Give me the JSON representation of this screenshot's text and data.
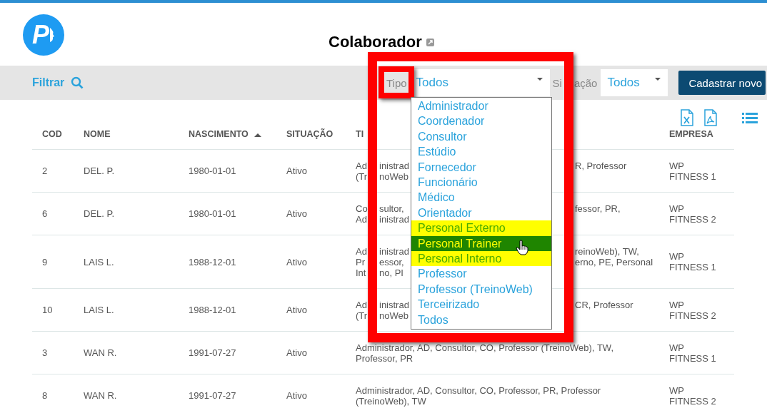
{
  "logo": {
    "text": "P"
  },
  "title": "Colaborador",
  "filter_bar": {
    "filter_label": "Filtrar",
    "tipo_label": "Tipo",
    "tipo_value": "Todos",
    "situacao_label": [
      "Si",
      "ação"
    ],
    "situacao_value": "Todos",
    "new_button": "Cadastrar novo"
  },
  "table": {
    "columns": [
      {
        "label": "COD",
        "sorted": false
      },
      {
        "label": "NOME",
        "sorted": false
      },
      {
        "label": "NASCIMENTO",
        "sorted": true
      },
      {
        "label": "SITUAÇÃO",
        "sorted": false
      },
      {
        "label": "TI",
        "sorted": false
      },
      {
        "label": "EMPRESA",
        "sorted": false
      }
    ],
    "rows": [
      {
        "cod": "2",
        "nome": "DEL. P.",
        "nascimento": "1980-01-01",
        "situacao": "Ativo",
        "tipo": [
          {
            "kind": "left",
            "lines": [
              "Ad",
              "(Tr"
            ]
          },
          {
            "kind": "middle",
            "lines": [
              "inistrad",
              "noWeb"
            ]
          },
          {
            "kind": "right",
            "lines": [
              "R, Professor"
            ]
          }
        ],
        "empresa": [
          "WP",
          "FITNESS 1"
        ]
      },
      {
        "cod": "6",
        "nome": "DEL. P.",
        "nascimento": "1980-01-01",
        "situacao": "Ativo",
        "tipo": [
          {
            "kind": "left",
            "lines": [
              "Co",
              "Ad"
            ]
          },
          {
            "kind": "middle",
            "lines": [
              "sultor,",
              "inistrad"
            ]
          },
          {
            "kind": "right",
            "lines": [
              "fessor, PR,"
            ]
          }
        ],
        "empresa": [
          "WP",
          "FITNESS 2"
        ]
      },
      {
        "cod": "9",
        "nome": "LAIS L.",
        "nascimento": "1988-12-01",
        "situacao": "Ativo",
        "tipo": [
          {
            "kind": "left",
            "lines": [
              "Ad",
              "Pr",
              "Int"
            ]
          },
          {
            "kind": "middle",
            "lines": [
              "inistrad",
              "essor,",
              "no, PI"
            ]
          },
          {
            "kind": "right",
            "lines": [
              "reinoWeb), TW,",
              "erno, PE, Personal"
            ]
          }
        ],
        "empresa": [
          "WP",
          "FITNESS 1"
        ]
      },
      {
        "cod": "10",
        "nome": "LAIS L.",
        "nascimento": "1988-12-01",
        "situacao": "Ativo",
        "tipo": [
          {
            "kind": "left",
            "lines": [
              "Ad",
              "(Tr"
            ]
          },
          {
            "kind": "middle",
            "lines": [
              "inistrad",
              "noWeb"
            ]
          },
          {
            "kind": "right",
            "lines": [
              "CR, Professor"
            ]
          }
        ],
        "empresa": [
          "WP",
          "FITNESS 2"
        ]
      },
      {
        "cod": "3",
        "nome": "WAN R.",
        "nascimento": "1991-07-27",
        "situacao": "Ativo",
        "tipo": [
          {
            "kind": "full",
            "lines": [
              "Administrador, AD, Consultor, CO, Professor (TreinoWeb), TW,",
              "Professor, PR"
            ]
          }
        ],
        "empresa": [
          "WP",
          "FITNESS 1"
        ]
      },
      {
        "cod": "8",
        "nome": "WAN R.",
        "nascimento": "1991-07-27",
        "situacao": "Ativo",
        "tipo": [
          {
            "kind": "full",
            "lines": [
              "Administrador, AD, Consultor, CO, Professor, PR, Professor",
              "(TreinoWeb), TW"
            ]
          }
        ],
        "empresa": [
          "WP",
          "FITNESS 2"
        ]
      }
    ]
  },
  "tipo_dropdown": {
    "options": [
      {
        "label": "Administrador",
        "selected": false,
        "highlighted": false
      },
      {
        "label": "Coordenador",
        "selected": false,
        "highlighted": false
      },
      {
        "label": "Consultor",
        "selected": false,
        "highlighted": false
      },
      {
        "label": "Estúdio",
        "selected": false,
        "highlighted": false
      },
      {
        "label": "Fornecedor",
        "selected": false,
        "highlighted": false
      },
      {
        "label": "Funcionário",
        "selected": false,
        "highlighted": false
      },
      {
        "label": "Médico",
        "selected": false,
        "highlighted": false
      },
      {
        "label": "Orientador",
        "selected": false,
        "highlighted": false
      },
      {
        "label": "Personal Externo",
        "selected": false,
        "highlighted": true
      },
      {
        "label": "Personal Trainer",
        "selected": true,
        "highlighted": false
      },
      {
        "label": "Personal Interno",
        "selected": false,
        "highlighted": true
      },
      {
        "label": "Professor",
        "selected": false,
        "highlighted": false
      },
      {
        "label": "Professor (TreinoWeb)",
        "selected": false,
        "highlighted": false
      },
      {
        "label": "Terceirizado",
        "selected": false,
        "highlighted": false
      },
      {
        "label": "Todos",
        "selected": false,
        "highlighted": false
      }
    ]
  }
}
